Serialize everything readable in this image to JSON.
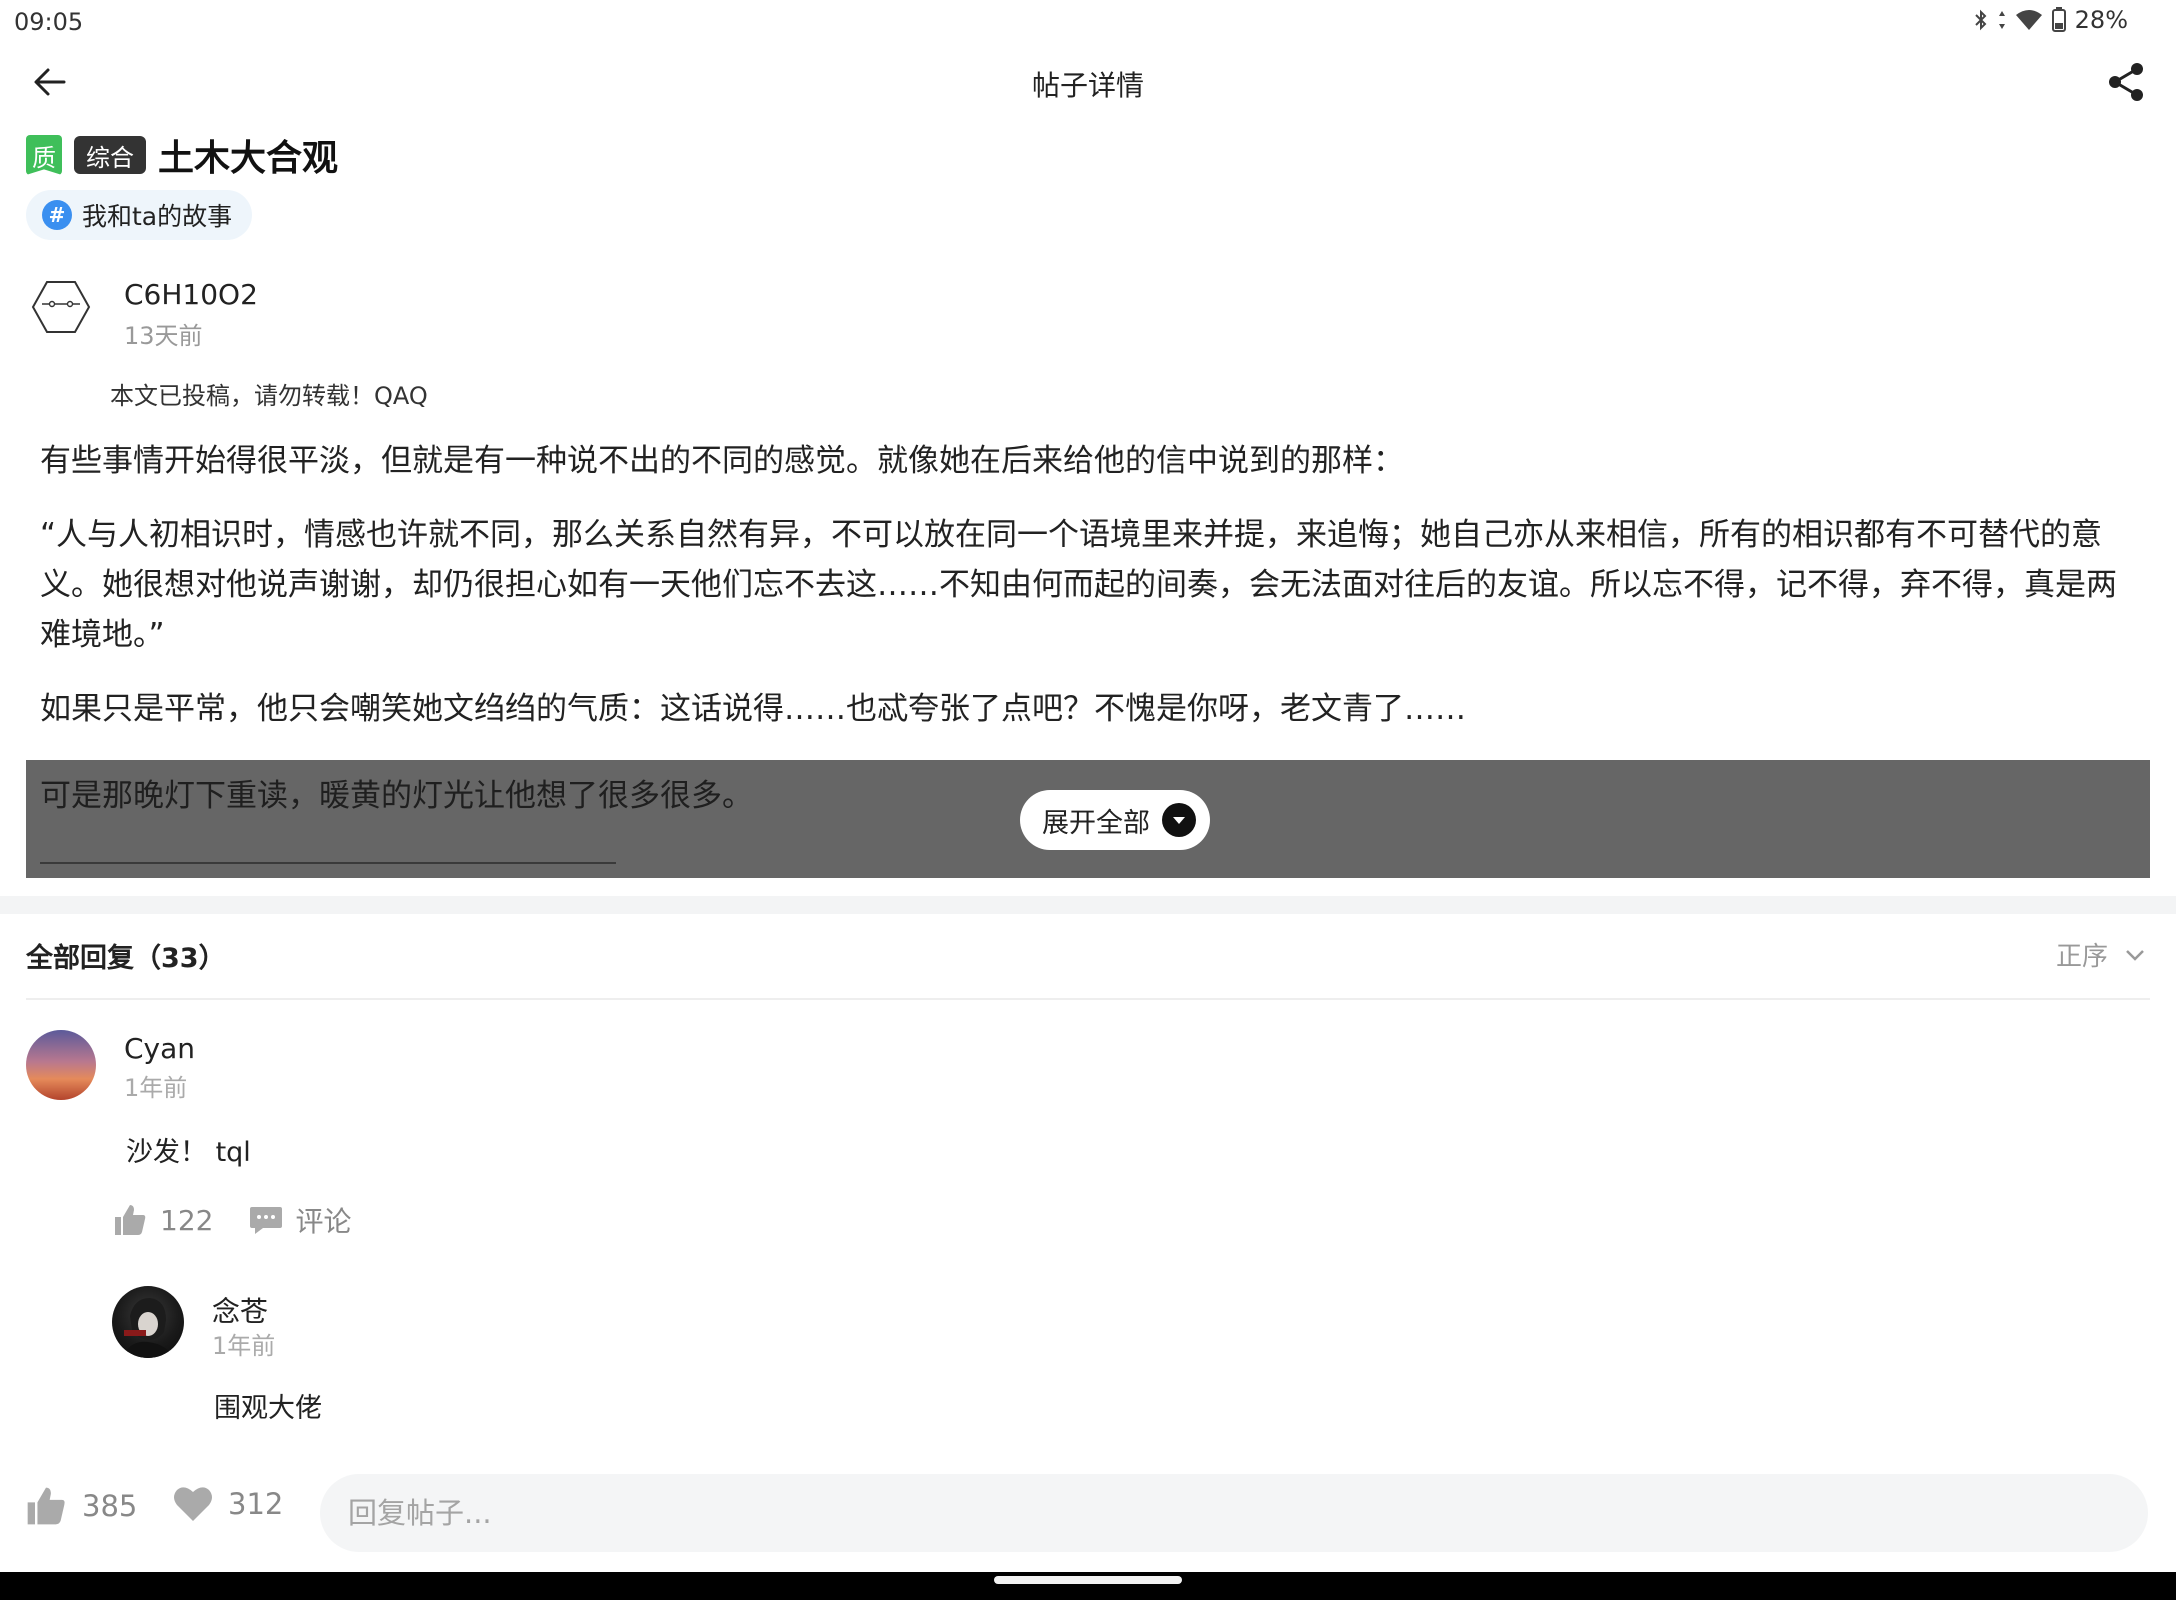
{
  "status_bar": {
    "time": "09:05",
    "battery": "28%",
    "icons": [
      "bluetooth-icon",
      "data-arrows-icon",
      "wifi-icon",
      "battery-icon"
    ]
  },
  "header": {
    "title": "帖子详情",
    "back_icon": "back-arrow-icon",
    "share_icon": "share-icon"
  },
  "post": {
    "quality_badge": "质",
    "category": "综合",
    "title": "土木大合观",
    "topic": {
      "icon": "#",
      "label": "我和ta的故事"
    },
    "author": {
      "name": "C6H10O2",
      "time": "13天前"
    },
    "notice": "本文已投稿，请勿转载！QAQ",
    "paragraphs": [
      "有些事情开始得很平淡，但就是有一种说不出的不同的感觉。就像她在后来给他的信中说到的那样：",
      "“人与人初相识时，情感也许就不同，那么关系自然有异，不可以放在同一个语境里来并提，来追悔；她自己亦从来相信，所有的相识都有不可替代的意义。她很想对他说声谢谢，却仍很担心如有一天他们忘不去这……不知由何而起的间奏，会无法面对往后的友谊。所以忘不得，记不得，弃不得，真是两难境地。”",
      "如果只是平常，他只会嘲笑她文绉绉的气质：这话说得……也忒夸张了点吧？不愧是你呀，老文青了……"
    ],
    "folded_line": "可是那晚灯下重读，暖黄的灯光让他想了很多很多。",
    "expand_label": "展开全部"
  },
  "replies": {
    "title": "全部回复（33）",
    "sort_label": "正序",
    "comments": [
      {
        "name": "Cyan",
        "time": "1年前",
        "text": "沙发！ tql",
        "likes": "122",
        "comment_label": "评论"
      }
    ],
    "sub_reply": {
      "name": "念苍",
      "time": "1年前",
      "text": "围观大佬"
    }
  },
  "bottom_bar": {
    "likes": "385",
    "favorites": "312",
    "reply_placeholder": "回复帖子..."
  },
  "colors": {
    "quality_green": "#3fbf5a",
    "topic_blue": "#3a8ff0",
    "fold_overlay": "#666666",
    "muted_text": "#999999"
  }
}
